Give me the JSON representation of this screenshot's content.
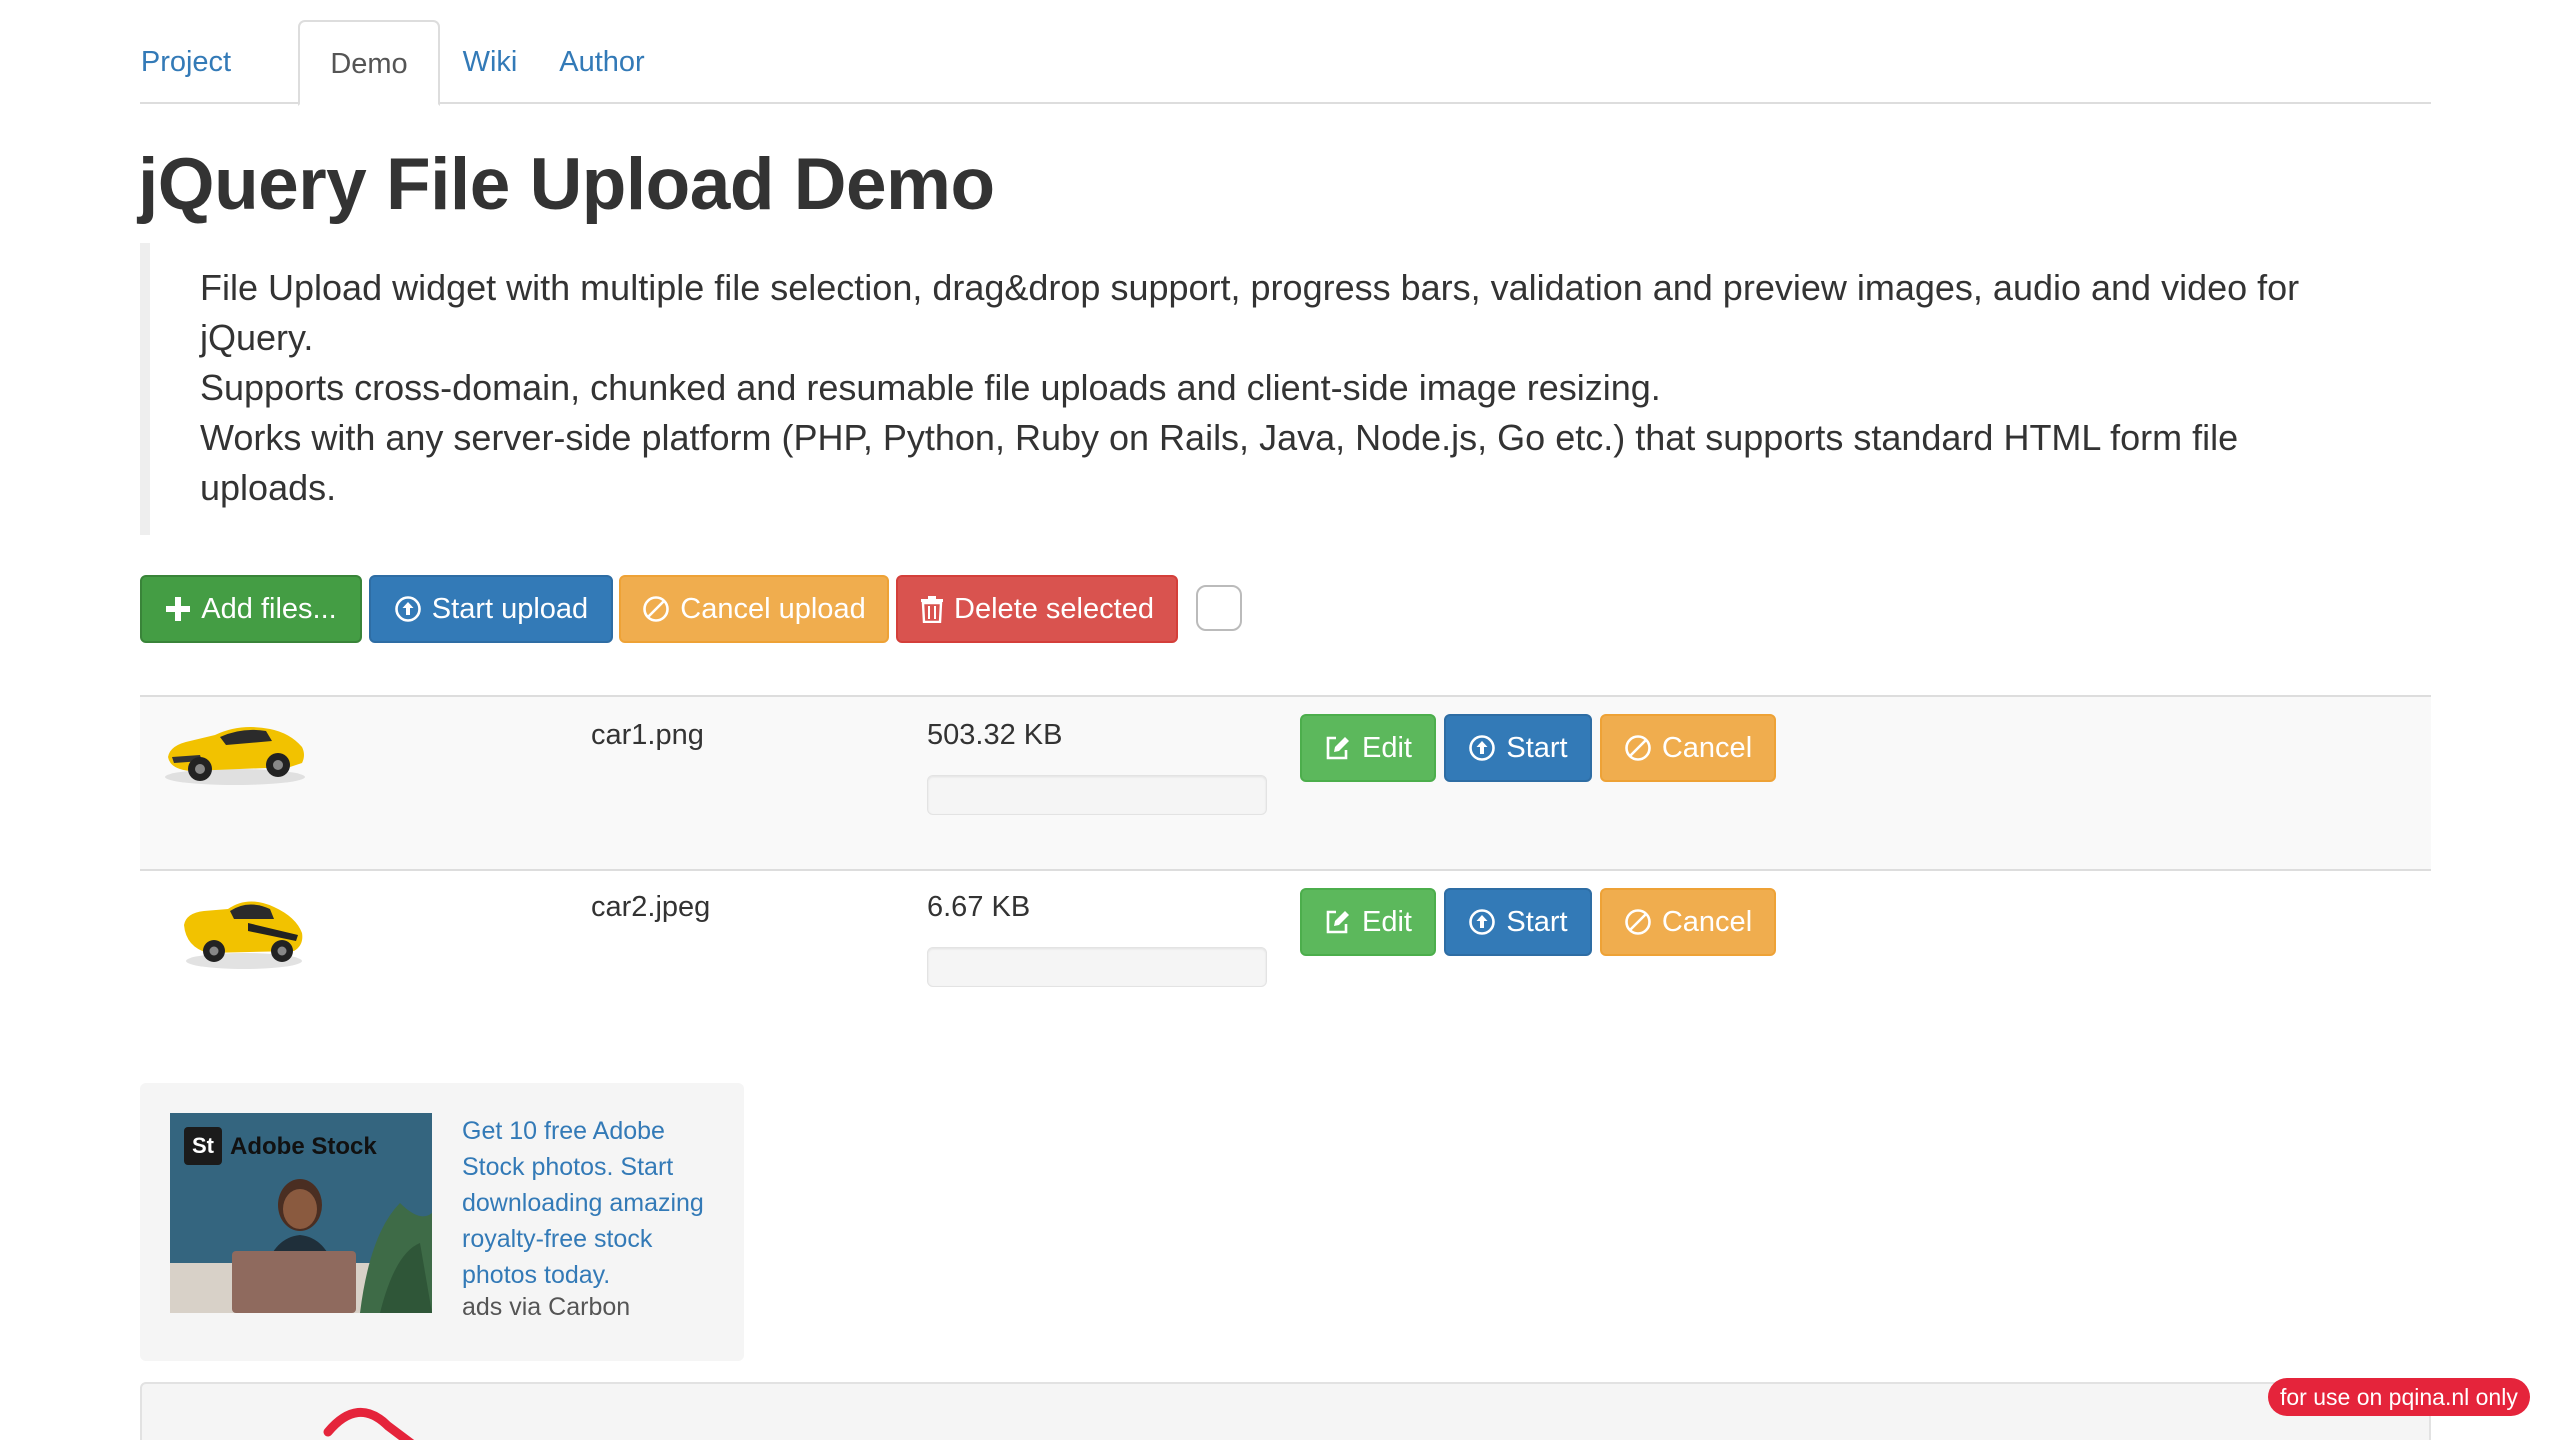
{
  "tabs": [
    {
      "label": "Project",
      "active": false
    },
    {
      "label": "Demo",
      "active": true
    },
    {
      "label": "Wiki",
      "active": false
    },
    {
      "label": "Author",
      "active": false
    }
  ],
  "title": "jQuery File Upload Demo",
  "description": {
    "line1": "File Upload widget with multiple file selection, drag&drop support, progress bars, validation and preview images, audio and video for jQuery.",
    "line2": "Supports cross-domain, chunked and resumable file uploads and client-side image resizing.",
    "line3": "Works with any server-side platform (PHP, Python, Ruby on Rails, Java, Node.js, Go etc.) that supports standard HTML form file uploads."
  },
  "toolbar": {
    "add_files": "Add files...",
    "start_upload": "Start upload",
    "cancel_upload": "Cancel upload",
    "delete_selected": "Delete selected",
    "select_all_checked": false
  },
  "files": [
    {
      "name": "car1.png",
      "size": "503.32 KB",
      "progress": 0,
      "thumbnail_icon": "yellow-car-thumbnail",
      "edit_label": "Edit",
      "start_label": "Start",
      "cancel_label": "Cancel"
    },
    {
      "name": "car2.jpeg",
      "size": "6.67 KB",
      "progress": 0,
      "thumbnail_icon": "yellow-car-thumbnail",
      "edit_label": "Edit",
      "start_label": "Start",
      "cancel_label": "Cancel"
    }
  ],
  "ad": {
    "brand": "Adobe Stock",
    "brand_mark": "St",
    "text": "Get 10 free Adobe Stock photos. Start downloading amazing royalty-free stock photos today.",
    "via": "ads via Carbon"
  },
  "pintura": {
    "badge": "for use on pqina.nl only"
  },
  "colors": {
    "link": "#337ab7",
    "success": "#5cb85c",
    "primary": "#337ab7",
    "warning": "#f0ad4e",
    "danger": "#d9534f",
    "pintura_red": "#e5243b"
  }
}
